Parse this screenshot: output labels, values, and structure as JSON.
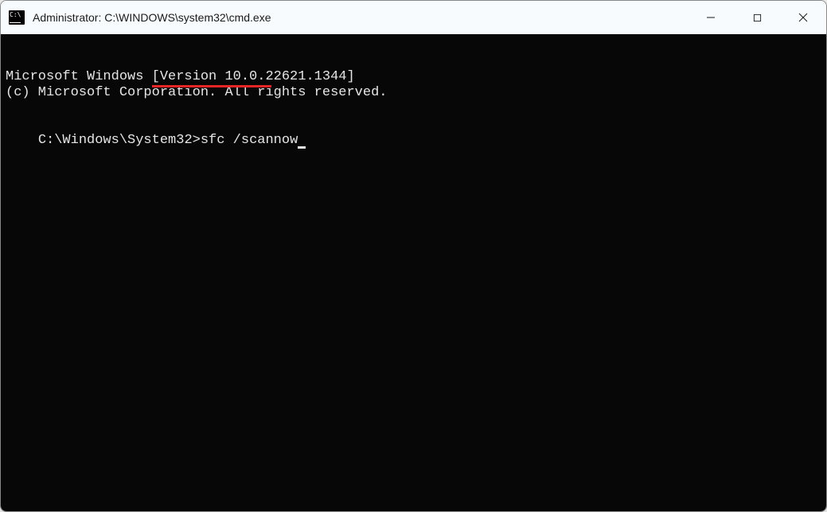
{
  "window": {
    "title": "Administrator: C:\\WINDOWS\\system32\\cmd.exe"
  },
  "console": {
    "line1": "Microsoft Windows [Version 10.0.22621.1344]",
    "line2": "(c) Microsoft Corporation. All rights reserved.",
    "prompt": "C:\\Windows\\System32>",
    "command": "sfc /scannow"
  },
  "annotation": {
    "underline_color": "#e62525"
  }
}
